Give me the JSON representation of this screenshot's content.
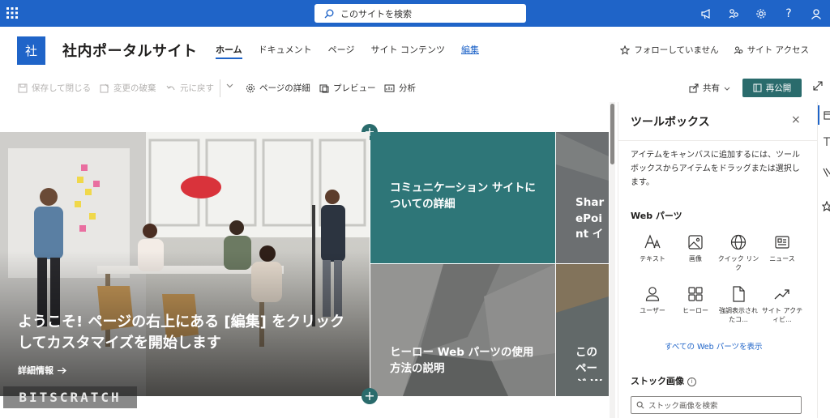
{
  "suite": {
    "search_placeholder": "このサイトを検索",
    "icons": [
      "megaphone-icon",
      "collaboration-icon",
      "gear-icon",
      "help-icon",
      "profile-icon"
    ],
    "help_glyph": "?"
  },
  "site": {
    "logo_letter": "社",
    "title": "社内ポータルサイト",
    "nav": [
      "ホーム",
      "ドキュメント",
      "ページ",
      "サイト コンテンツ",
      "編集"
    ],
    "follow": "フォローしていません",
    "access": "サイト アクセス"
  },
  "commands": {
    "save_close": "保存して閉じる",
    "discard": "変更の破棄",
    "undo": "元に戻す",
    "page_details": "ページの詳細",
    "preview": "プレビュー",
    "analytics": "分析",
    "share": "共有",
    "republish": "再公開"
  },
  "hero": {
    "main_caption": "ようこそ! ページの右上にある [編集] をクリックしてカスタマイズを開始します",
    "main_link": "詳細情報",
    "tile2": "コミュニケーション サイトについての詳細",
    "tile3": "SharePoint インストールす",
    "tile4": "ヒーロー Web パーツの使用方法の説明",
    "tile5": "このページ Web パ"
  },
  "watermark": "BITSCRATCH",
  "toolbox": {
    "title": "ツールボックス",
    "close": "×",
    "description": "アイテムをキャンバスに追加するには、ツールボックスからアイテムをドラッグまたは選択します。",
    "webparts_heading": "Web パーツ",
    "webparts": [
      {
        "label": "テキスト",
        "icon": "text-icon"
      },
      {
        "label": "画像",
        "icon": "image-icon"
      },
      {
        "label": "クイック リンク",
        "icon": "globe-icon"
      },
      {
        "label": "ニュース",
        "icon": "news-icon"
      },
      {
        "label": "ユーザー",
        "icon": "person-icon"
      },
      {
        "label": "ヒーロー",
        "icon": "hero-icon"
      },
      {
        "label": "強調表示されたコ...",
        "icon": "document-icon"
      },
      {
        "label": "サイト アクティビ...",
        "icon": "activity-icon"
      }
    ],
    "all_webparts": "すべての Web パーツを表示",
    "stock_heading": "ストック画像",
    "stock_search": "ストック画像を検索",
    "info_glyph": "i"
  },
  "colors": {
    "suite_blue": "#1f64c8",
    "teal": "#2a6b6c",
    "link_blue": "#1f64c8"
  }
}
